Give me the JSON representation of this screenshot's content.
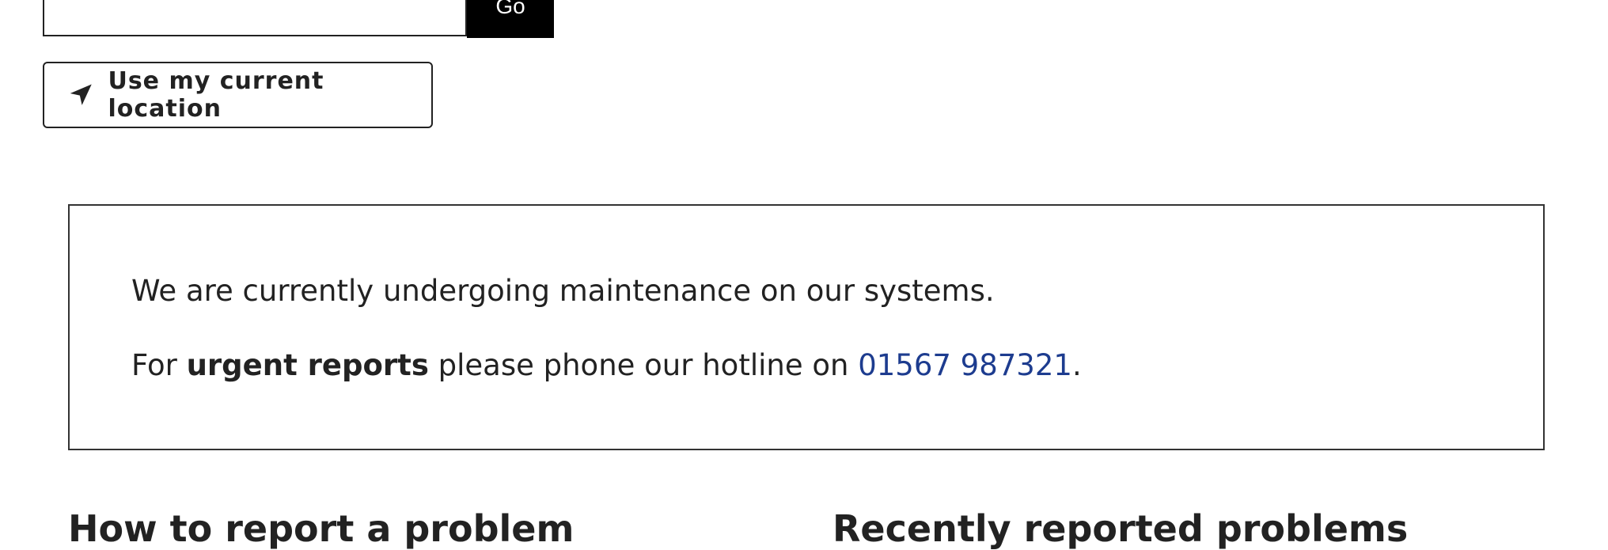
{
  "search": {
    "value": "",
    "go_label": "Go"
  },
  "location_button": {
    "label": "Use my current location",
    "icon": "navigation-arrow-icon"
  },
  "notice": {
    "line1": "We are currently undergoing maintenance on our systems.",
    "line2_prefix": "For ",
    "line2_bold": "urgent reports",
    "line2_middle": " please phone our hotline on ",
    "phone": "01567 987321",
    "line2_suffix": "."
  },
  "sections": {
    "left_heading": "How to report a problem",
    "right_heading": "Recently reported problems"
  },
  "colors": {
    "text": "#222222",
    "link": "#1d3c8f",
    "go_button_bg": "#000000"
  }
}
